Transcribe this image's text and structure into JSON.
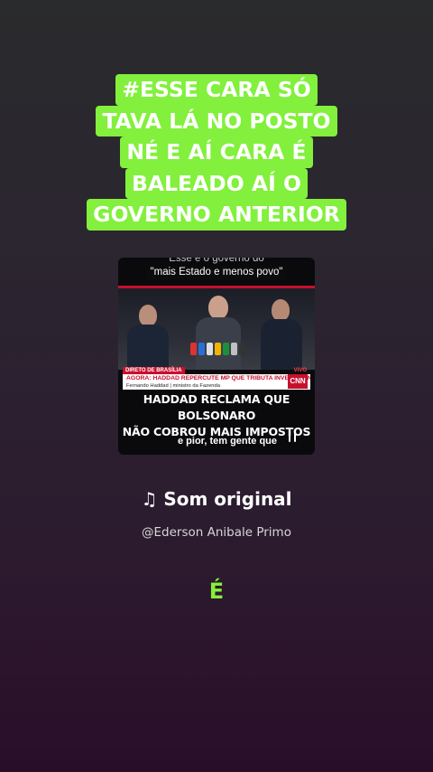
{
  "caption": {
    "lines": [
      "#ESSE CARA SÓ",
      "TAVA LÁ NO POSTO",
      "NÉ E AÍ CARA É",
      "BALEADO AÍ O",
      "GOVERNO ANTERIOR"
    ],
    "highlight_color": "#82f03c"
  },
  "video": {
    "top_subtitle_line1": "Esse é o governo do",
    "top_subtitle_line2": "\"mais Estado e menos povo\"",
    "live_tag": "DIRETO DE BRASÍLIA",
    "vivo_tag": "VIVO",
    "headline": "AGORA: HADDAD REPERCUTE MP QUE TRIBUTA INVESTIMENTOS",
    "name_line": "Fernando Haddad  |  ministro da Fazenda",
    "logo": "CNN",
    "big_title_line1": "HADDAD RECLAMA QUE BOLSONARO",
    "big_title_line2": "NÃO COBROU MAIS IMPOSTOS",
    "bottom_subtitle": "e pior, tem gente que",
    "pause_icon": "pause-icon"
  },
  "sound": {
    "title": "♫ Som original",
    "author": "@Ederson Anibale Primo"
  },
  "lyric": {
    "text": "É",
    "color": "#86f03a"
  }
}
